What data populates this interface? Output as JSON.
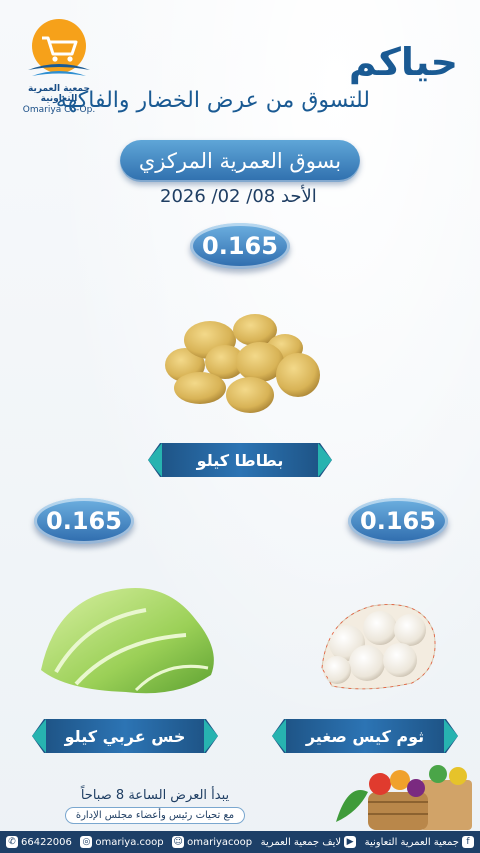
{
  "brand": {
    "name_ar": "جمعية العمرية التعاونية",
    "name_en": "Omariya Co-Op."
  },
  "header": {
    "welcome": "حياكم",
    "subtitle": "للتسوق من عرض الخضار والفاكهة",
    "market": "بسوق العمرية المركزي",
    "date": "الأحد 08/ 02/ 2026"
  },
  "products": [
    {
      "price": "0.165",
      "label": "بطاطا كيلو",
      "image": "potatoes"
    },
    {
      "price": "0.165",
      "label": "خس عربي كيلو",
      "image": "lettuce"
    },
    {
      "price": "0.165",
      "label": "ثوم كيس صغير",
      "image": "garlic-bag"
    }
  ],
  "info": {
    "start_time": "يبدأ العرض الساعة 8 صباحاً",
    "greeting": "مع تحيات رئيس وأعضاء مجلس الإدارة"
  },
  "footer": {
    "whatsapp": "66422006",
    "instagram": "omariya.coop",
    "snapchat": "omariyacoop",
    "youtube": "لايف جمعية العمرية",
    "facebook": "جمعية العمرية التعاونية"
  },
  "colors": {
    "primary": "#1a5a93",
    "accent": "#27b3b0",
    "footer": "#1d3f67"
  }
}
